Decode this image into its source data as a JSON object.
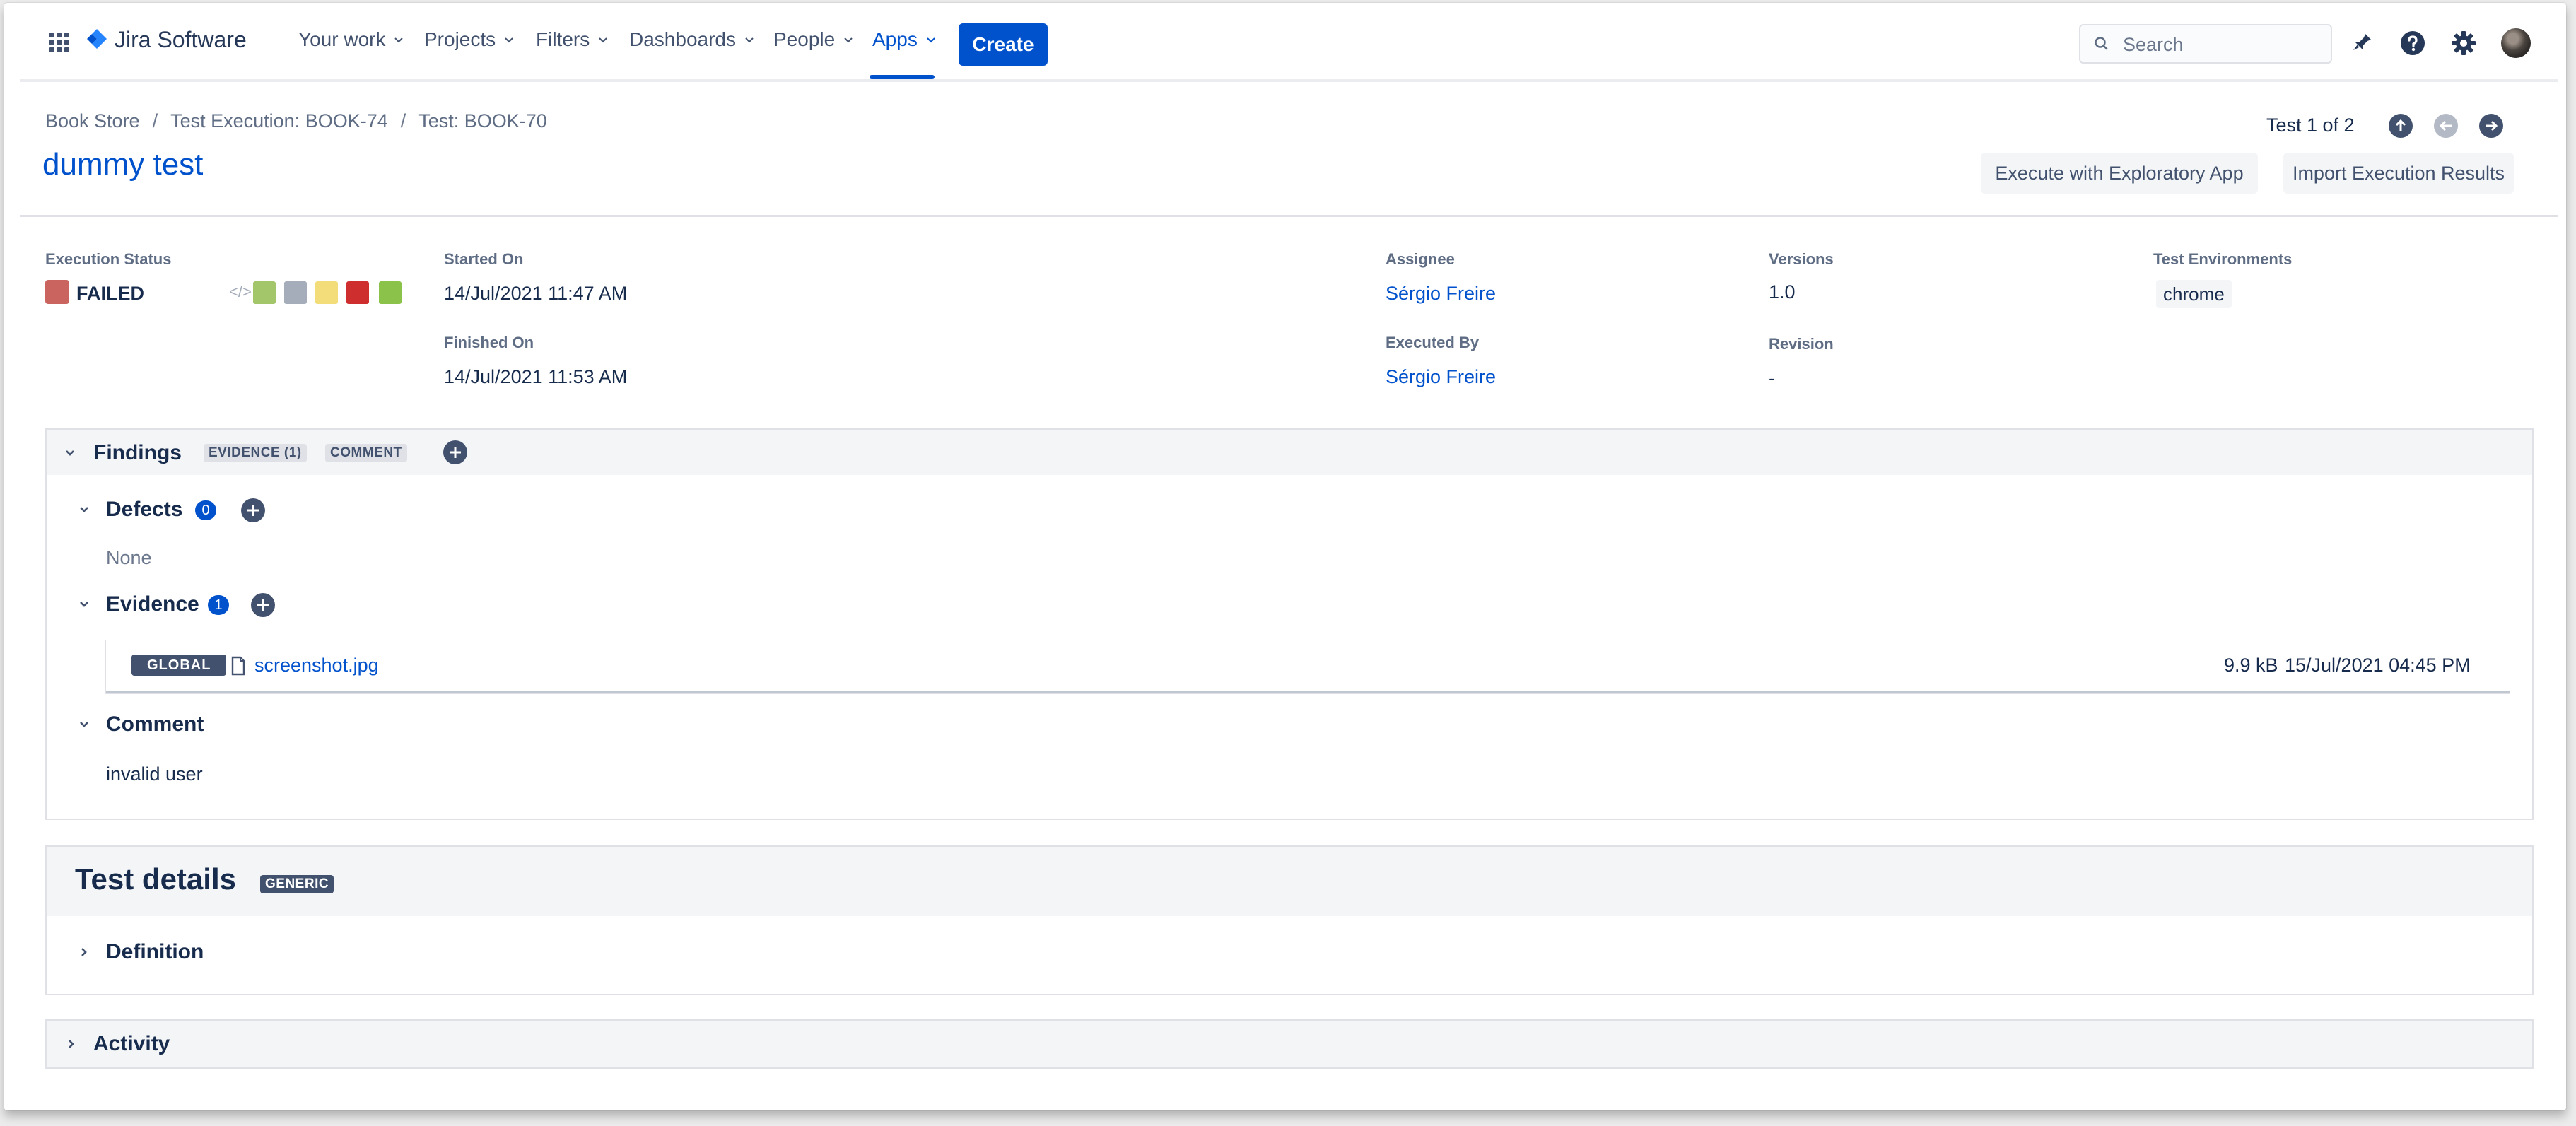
{
  "nav": {
    "logo_text": "Jira Software",
    "items": [
      "Your work",
      "Projects",
      "Filters",
      "Dashboards",
      "People",
      "Apps"
    ],
    "create_label": "Create",
    "search_placeholder": "Search",
    "icons": [
      "app-switcher-icon",
      "jira-logo-icon",
      "notifications-icon",
      "help-icon",
      "settings-icon",
      "user-avatar"
    ]
  },
  "breadcrumbs": [
    "Book Store",
    "Test Execution: BOOK-74",
    "Test: BOOK-70"
  ],
  "breadcrumb_separator": "/",
  "page_title": "dummy test",
  "pager": {
    "text": "Test 1 of 2"
  },
  "actions": {
    "exploratory": "Execute with Exploratory App",
    "import": "Import Execution Results"
  },
  "fields": {
    "execution_status": {
      "label": "Execution Status",
      "value": "FAILED",
      "color": "#c9645e"
    },
    "status_palette": [
      "#a4c66a",
      "#a5adba",
      "#f3dc7a",
      "#cf2e2e",
      "#8bc34a"
    ],
    "started_on": {
      "label": "Started On",
      "value": "14/Jul/2021 11:47 AM"
    },
    "finished_on": {
      "label": "Finished On",
      "value": "14/Jul/2021 11:53 AM"
    },
    "assignee": {
      "label": "Assignee",
      "value": "Sérgio Freire"
    },
    "executed_by": {
      "label": "Executed By",
      "value": "Sérgio Freire"
    },
    "versions": {
      "label": "Versions",
      "value": "1.0"
    },
    "revision": {
      "label": "Revision",
      "value": "-"
    },
    "test_environments": {
      "label": "Test Environments",
      "value": "chrome"
    }
  },
  "findings": {
    "title": "Findings",
    "tags": [
      "EVIDENCE (1)",
      "COMMENT"
    ],
    "defects": {
      "title": "Defects",
      "count": "0",
      "empty_text": "None"
    },
    "evidence": {
      "title": "Evidence",
      "count": "1",
      "items": [
        {
          "scope": "GLOBAL",
          "filename": "screenshot.jpg",
          "size": "9.9 kB",
          "date": "15/Jul/2021 04:45 PM"
        }
      ]
    },
    "comment": {
      "title": "Comment",
      "text": "invalid user"
    }
  },
  "test_details": {
    "title": "Test details",
    "type": "GENERIC",
    "definition_label": "Definition"
  },
  "activity": {
    "title": "Activity"
  },
  "colors": {
    "brand": "#0052cc",
    "text": "#172b4d",
    "muted": "#5e6c84",
    "failed": "#c9645e"
  }
}
